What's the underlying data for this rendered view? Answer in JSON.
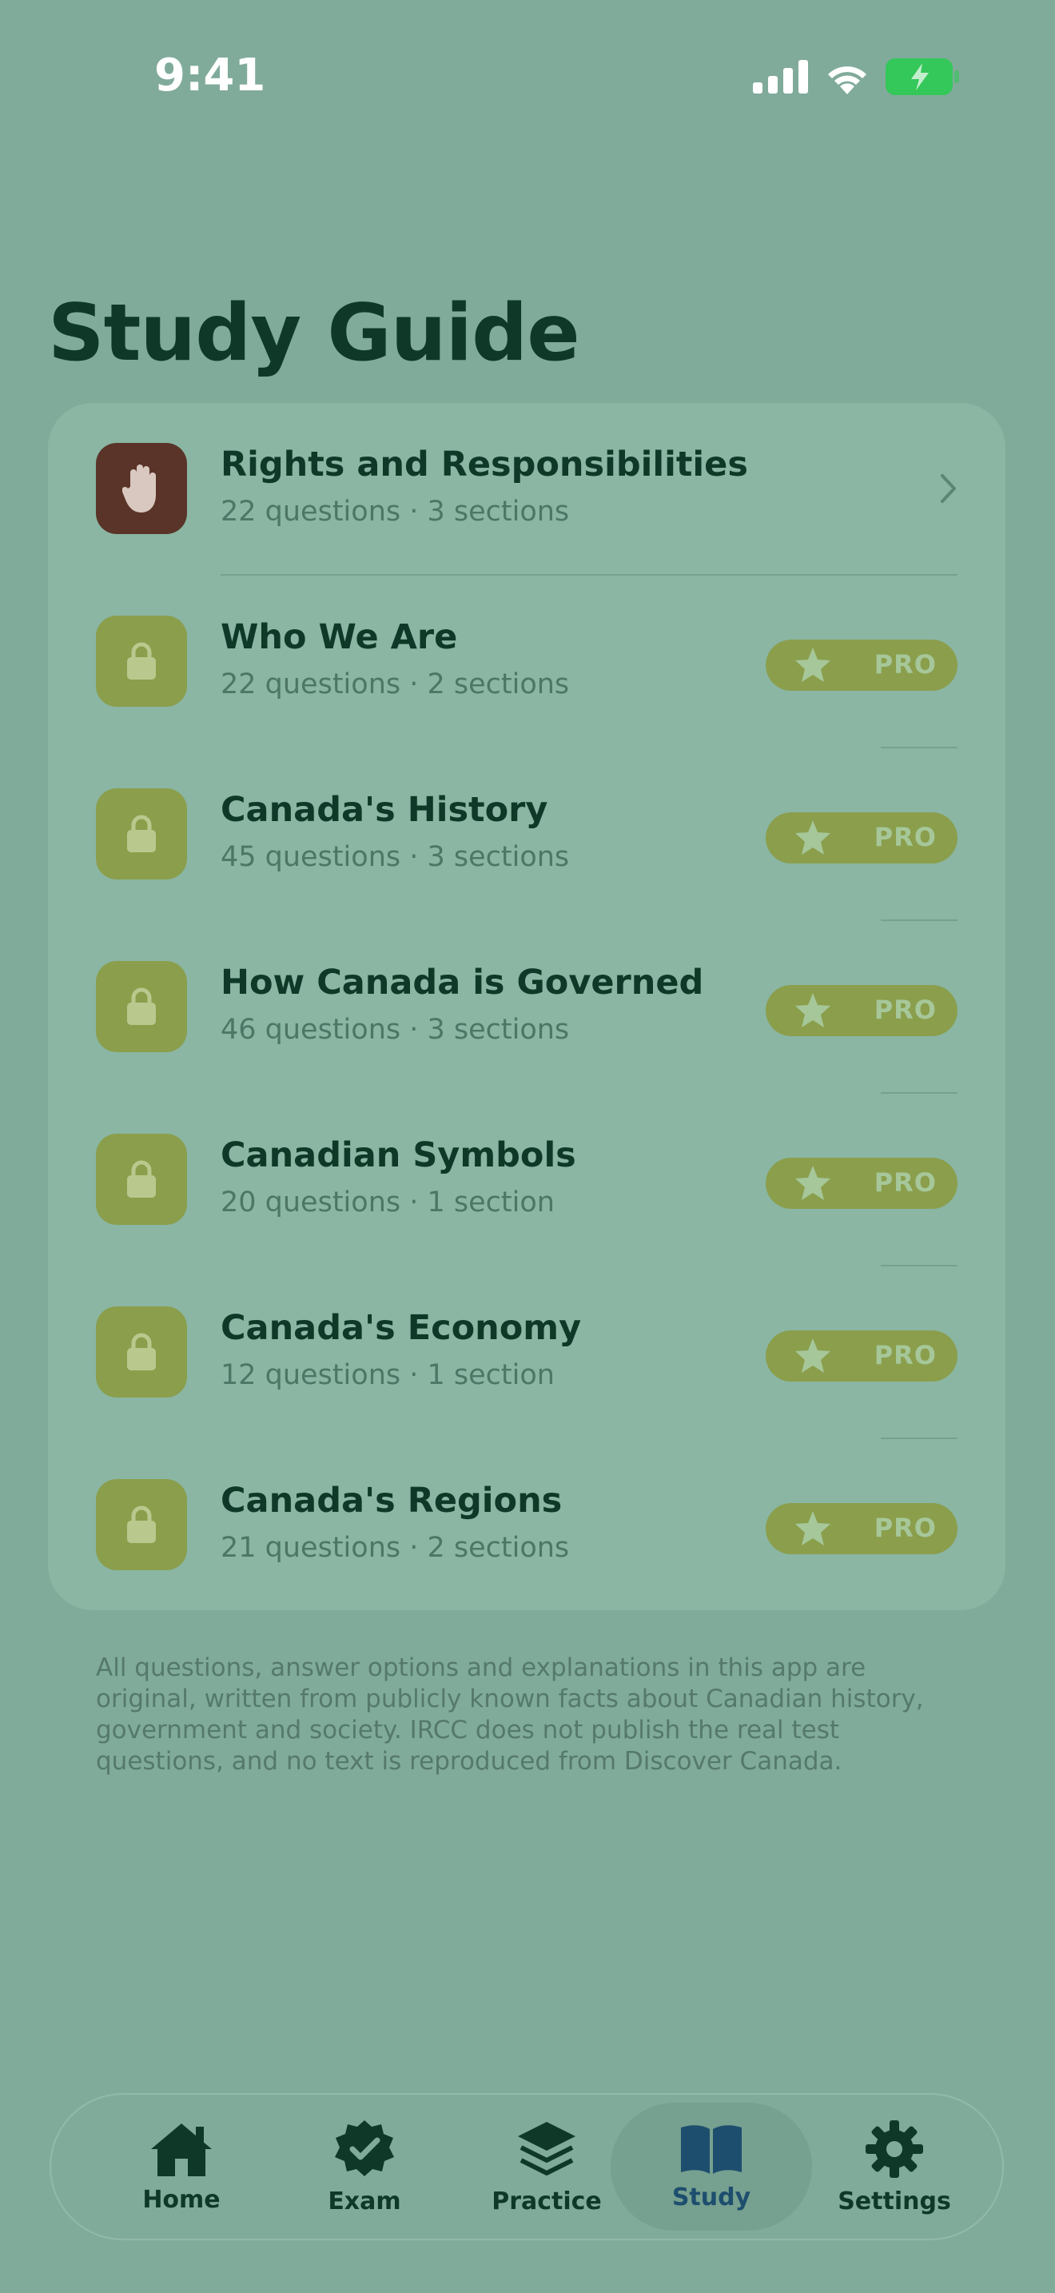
{
  "status_bar": {
    "time": "9:41"
  },
  "page_title": "Study Guide",
  "topics": [
    {
      "title": "Rights and Responsibilities",
      "subtitle": "22 questions · 3 sections",
      "locked": false,
      "icon": "hand-icon"
    },
    {
      "title": "Who We Are",
      "subtitle": "22 questions · 2 sections",
      "locked": true,
      "badge": "PRO"
    },
    {
      "title": "Canada's History",
      "subtitle": "45 questions · 3 sections",
      "locked": true,
      "badge": "PRO"
    },
    {
      "title": "How Canada is Governed",
      "subtitle": "46 questions · 3 sections",
      "locked": true,
      "badge": "PRO"
    },
    {
      "title": "Canadian Symbols",
      "subtitle": "20 questions · 1 section",
      "locked": true,
      "badge": "PRO"
    },
    {
      "title": "Canada's Economy",
      "subtitle": "12 questions · 1 section",
      "locked": true,
      "badge": "PRO"
    },
    {
      "title": "Canada's Regions",
      "subtitle": "21 questions · 2 sections",
      "locked": true,
      "badge": "PRO"
    }
  ],
  "disclaimer": "All questions, answer options and explanations in this app are original, written from publicly known facts about Canadian history, government and society. IRCC does not publish the real test questions, and no text is reproduced from Discover Canada.",
  "tab_bar": {
    "tabs": [
      {
        "label": "Home",
        "icon": "house-icon"
      },
      {
        "label": "Exam",
        "icon": "checkmark-seal-icon"
      },
      {
        "label": "Practice",
        "icon": "stack-icon"
      },
      {
        "label": "Study",
        "icon": "book-icon",
        "selected": true
      },
      {
        "label": "Settings",
        "icon": "gear-icon"
      }
    ]
  },
  "colors": {
    "background": "#80ab9a",
    "card": "#8ab6a3",
    "title_text": "#0f3828",
    "locked_icon_bg": "#8a9e4c",
    "active_icon_bg": "#5a3428",
    "selected_tab": "#1e4e6e"
  }
}
